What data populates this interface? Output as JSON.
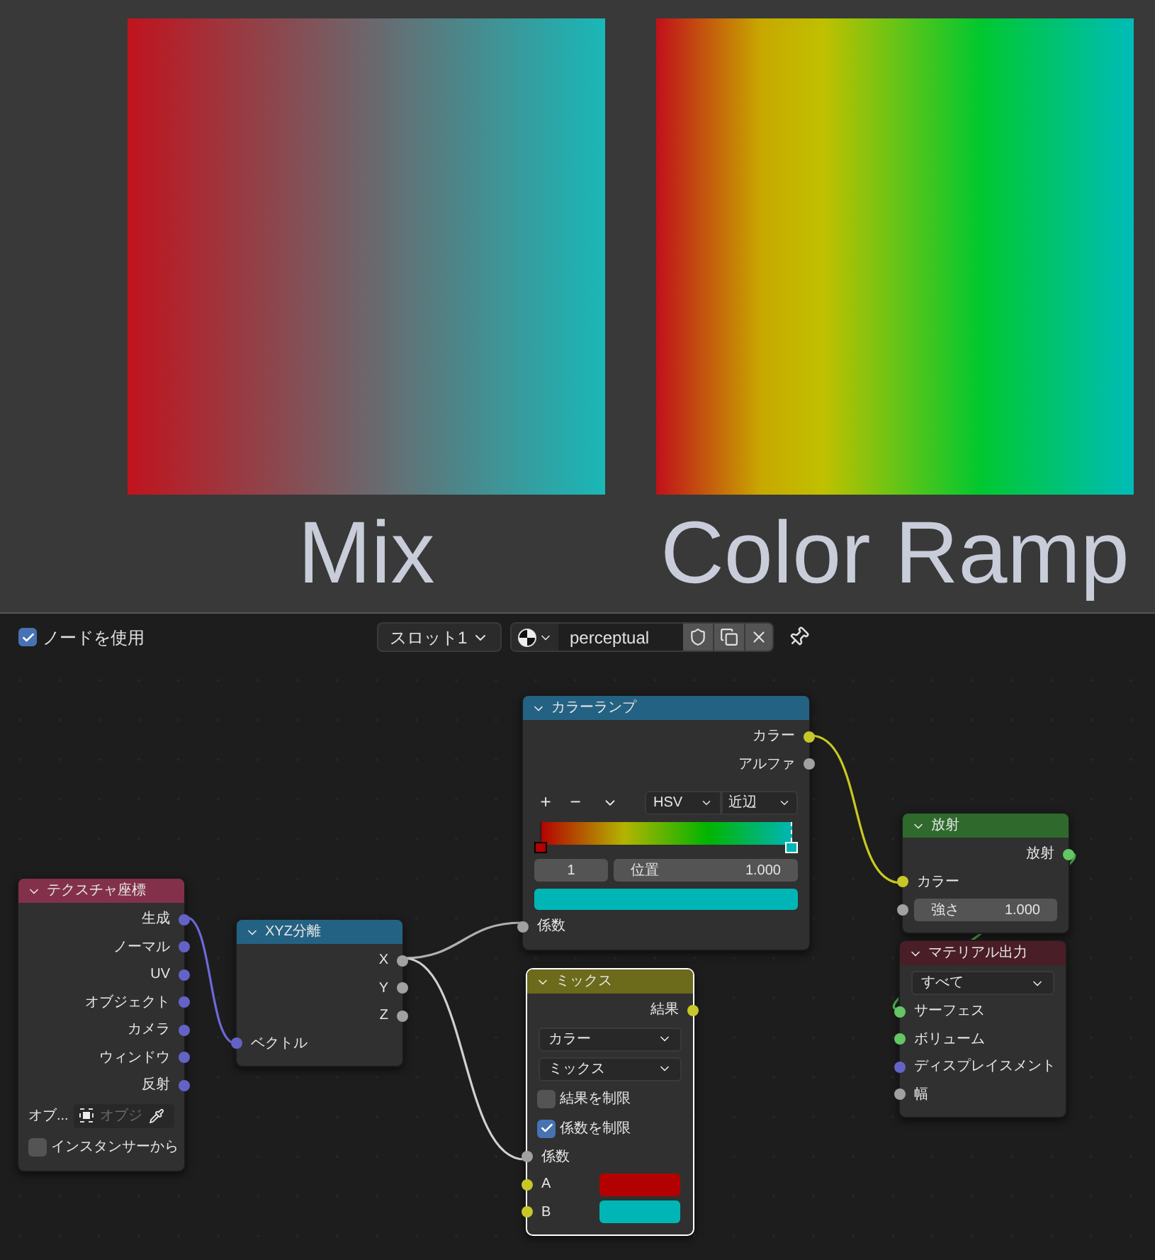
{
  "viewport": {
    "panels": [
      {
        "kind": "mix",
        "label": "Mix"
      },
      {
        "kind": "ramp",
        "label": "Color Ramp"
      }
    ]
  },
  "header": {
    "use_nodes": {
      "label": "ノードを使用",
      "checked": true
    },
    "slot": "スロット1",
    "material": "perceptual"
  },
  "nodes": [
    {
      "kind": "texcoord",
      "title": "テクスチャ座標",
      "color": "#83314a",
      "selected": false,
      "rows": [
        {
          "kind": "out",
          "label": "生成",
          "socket": {
            "color": "#6363c7"
          }
        },
        {
          "kind": "out",
          "label": "ノーマル",
          "socket": {
            "color": "#6363c7"
          }
        },
        {
          "kind": "out",
          "label": "UV",
          "socket": {
            "color": "#6363c7"
          }
        },
        {
          "kind": "out",
          "label": "オブジェクト",
          "socket": {
            "color": "#6363c7"
          }
        },
        {
          "kind": "out",
          "label": "カメラ",
          "socket": {
            "color": "#6363c7"
          }
        },
        {
          "kind": "out",
          "label": "ウィンドウ",
          "socket": {
            "color": "#6363c7"
          }
        },
        {
          "kind": "out",
          "label": "反射",
          "socket": {
            "color": "#6363c7"
          }
        },
        {
          "kind": "object",
          "label": "オブ...",
          "placeholder": "オブジ"
        },
        {
          "kind": "check",
          "label": "インスタンサーから",
          "checked": false
        }
      ]
    },
    {
      "kind": "separate",
      "title": "XYZ分離",
      "color": "#246283",
      "selected": false,
      "rows": [
        {
          "kind": "out",
          "label": "X",
          "socket": {
            "color": "#a1a1a1"
          }
        },
        {
          "kind": "out",
          "label": "Y",
          "socket": {
            "color": "#a1a1a1"
          }
        },
        {
          "kind": "out",
          "label": "Z",
          "socket": {
            "color": "#a1a1a1"
          }
        },
        {
          "kind": "in",
          "label": "ベクトル",
          "socket": {
            "color": "#6363c7"
          }
        }
      ]
    },
    {
      "kind": "colorramp",
      "title": "カラーランプ",
      "color": "#246283",
      "selected": false,
      "rows": [
        {
          "kind": "out",
          "label": "カラー",
          "socket": {
            "color": "#c7c729"
          }
        },
        {
          "kind": "out",
          "label": "アルファ",
          "socket": {
            "color": "#a1a1a1"
          }
        },
        {
          "kind": "tools",
          "add": "+",
          "remove": "−",
          "mode": "HSV",
          "interpolation": "近辺"
        },
        {
          "kind": "ramp",
          "stops": [
            {
              "color": "#b30000",
              "level": 0,
              "selected": false
            },
            {
              "color": "#00b5b5",
              "level": 1,
              "selected": true
            }
          ]
        },
        {
          "kind": "stop",
          "index": "1",
          "label": "位置",
          "value": "1.000"
        },
        {
          "kind": "swatch",
          "color": "#00b5b5"
        },
        {
          "kind": "in",
          "label": "係数",
          "socket": {
            "color": "#a1a1a1"
          }
        }
      ]
    },
    {
      "kind": "mix",
      "title": "ミックス",
      "color": "#6b6b1b",
      "selected": true,
      "rows": [
        {
          "kind": "out",
          "label": "結果",
          "socket": {
            "color": "#c7c729"
          }
        },
        {
          "kind": "select",
          "value": "カラー"
        },
        {
          "kind": "select",
          "value": "ミックス"
        },
        {
          "kind": "check",
          "label": "結果を制限",
          "checked": false
        },
        {
          "kind": "check",
          "label": "係数を制限",
          "checked": true
        },
        {
          "kind": "in",
          "label": "係数",
          "socket": {
            "color": "#a1a1a1"
          }
        },
        {
          "kind": "color_in",
          "label": "A",
          "socket": {
            "color": "#c7c729"
          },
          "color": "#b30000"
        },
        {
          "kind": "color_in",
          "label": "B",
          "socket": {
            "color": "#c7c729"
          },
          "color": "#00b5b5"
        }
      ]
    },
    {
      "kind": "emission",
      "title": "放射",
      "color": "#2f6a2c",
      "selected": false,
      "rows": [
        {
          "kind": "out",
          "label": "放射",
          "socket": {
            "color": "#63c763"
          }
        },
        {
          "kind": "in",
          "label": "カラー",
          "socket": {
            "color": "#c7c729"
          }
        },
        {
          "kind": "field",
          "label": "強さ",
          "value": "1.000",
          "socket": {
            "color": "#a1a1a1"
          }
        }
      ]
    },
    {
      "kind": "output",
      "title": "マテリアル出力",
      "color": "#4a1e27",
      "selected": false,
      "rows": [
        {
          "kind": "select",
          "value": "すべて"
        },
        {
          "kind": "in",
          "label": "サーフェス",
          "socket": {
            "color": "#63c763"
          }
        },
        {
          "kind": "in",
          "label": "ボリューム",
          "socket": {
            "color": "#63c763"
          }
        },
        {
          "kind": "in",
          "label": "ディスプレイスメント",
          "socket": {
            "color": "#6363c7"
          }
        },
        {
          "kind": "in",
          "label": "幅",
          "socket": {
            "color": "#a1a1a1"
          }
        }
      ]
    }
  ]
}
